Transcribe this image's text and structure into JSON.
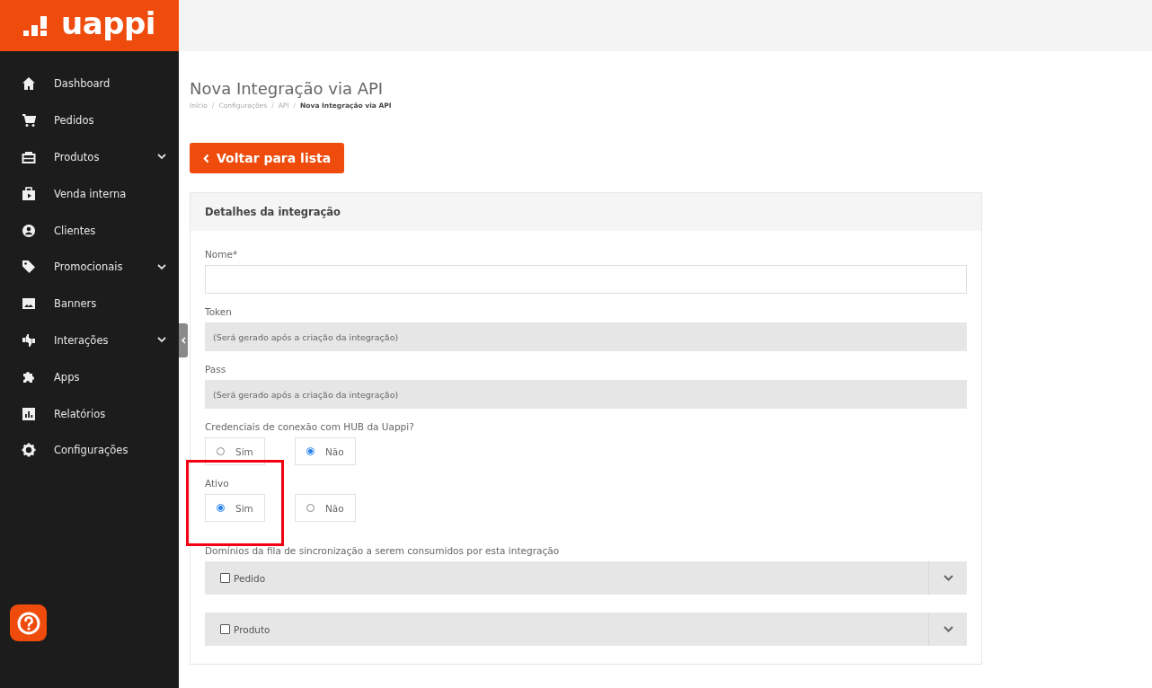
{
  "brand": {
    "logo_text": "uappi"
  },
  "sidebar": {
    "items": [
      {
        "label": "Dashboard",
        "expandable": false
      },
      {
        "label": "Pedidos",
        "expandable": false
      },
      {
        "label": "Produtos",
        "expandable": true
      },
      {
        "label": "Venda interna",
        "expandable": false
      },
      {
        "label": "Clientes",
        "expandable": false
      },
      {
        "label": "Promocionais",
        "expandable": true
      },
      {
        "label": "Banners",
        "expandable": false
      },
      {
        "label": "Interações",
        "expandable": true
      },
      {
        "label": "Apps",
        "expandable": false
      },
      {
        "label": "Relatórios",
        "expandable": false
      },
      {
        "label": "Configurações",
        "expandable": false
      }
    ]
  },
  "page": {
    "title": "Nova Integração via API",
    "breadcrumb_separator": "/",
    "breadcrumb": [
      {
        "label": "Início",
        "current": false
      },
      {
        "label": "Configurações",
        "current": false
      },
      {
        "label": "API",
        "current": false
      },
      {
        "label": "Nova Integração via API",
        "current": true
      }
    ],
    "back_button": "Voltar para lista"
  },
  "card": {
    "title": "Detalhes da integração",
    "fields": [
      {
        "label": "Nome*",
        "kind": "text",
        "disabled": false
      },
      {
        "label": "Token",
        "kind": "text",
        "disabled": true,
        "placeholder": "(Será gerado após a criação da integração)"
      },
      {
        "label": "Pass",
        "kind": "text",
        "disabled": true,
        "placeholder": "(Será gerado após a criação da integração)"
      },
      {
        "label": "Credenciais de conexão com HUB da Uappi?",
        "kind": "radio",
        "options": [
          {
            "label": "Sim",
            "selected": false
          },
          {
            "label": "Não",
            "selected": true
          }
        ]
      },
      {
        "label": "Ativo",
        "kind": "radio",
        "highlighted": true,
        "options": [
          {
            "label": "Sim",
            "selected": true
          },
          {
            "label": "Não",
            "selected": false
          }
        ]
      },
      {
        "label": "Domínios da fila de sincronização a serem consumidos por esta integração",
        "kind": "checklist",
        "items": [
          {
            "label": "Pedido",
            "checked": false
          },
          {
            "label": "Produto",
            "checked": false
          }
        ]
      }
    ]
  }
}
